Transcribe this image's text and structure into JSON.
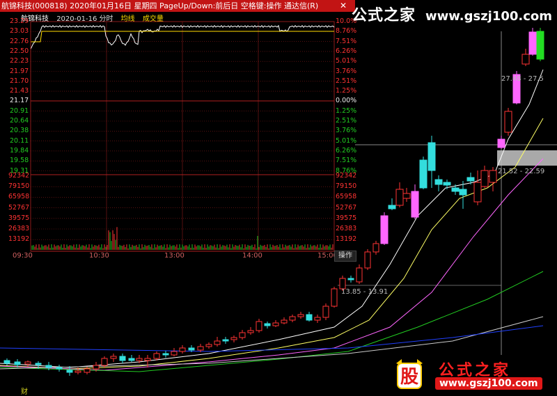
{
  "titlebar": {
    "text": "航锦科技(000818)  2020年01月16日  星期四  PageUp/Down:前后日  空格键:操作  通达信(R)",
    "close": "✕"
  },
  "subtitle": {
    "name": "航锦科技",
    "date": "2020-01-16 分时",
    "avg": "均线",
    "vol": "成交量"
  },
  "price_labels": [
    "23.29",
    "23.03",
    "22.76",
    "22.50",
    "22.23",
    "21.97",
    "21.70",
    "21.43",
    "21.17",
    "20.91",
    "20.64",
    "20.38",
    "20.11",
    "19.84",
    "19.58",
    "19.31"
  ],
  "pct_labels": [
    "10.0%",
    "8.76%",
    "7.51%",
    "6.26%",
    "5.01%",
    "3.76%",
    "2.51%",
    "1.25%",
    "0.00%",
    "1.25%",
    "2.51%",
    "3.76%",
    "5.01%",
    "6.26%",
    "7.51%",
    "8.76%"
  ],
  "volume_labels": [
    "92342",
    "79150",
    "65958",
    "52767",
    "39575",
    "26383",
    "13192"
  ],
  "time_labels": [
    "09:30",
    "10:30",
    "13:00",
    "14:00",
    "15:00"
  ],
  "operation_button": "操作",
  "range_labels": {
    "r1": "27.48 - 27.5",
    "r2": "21.52 - 22.59",
    "r3": "13.85 - 13.91"
  },
  "brand": {
    "top_cn": "公式之家",
    "top_url": "www.gszj100.com",
    "bottom_cn": "公式之家",
    "bottom_url": "www.gszj100.com",
    "logo_char": "股"
  },
  "bottom_marker": "财",
  "colors": {
    "up": "#ff3333",
    "down": "#22dddd",
    "magenta": "#ff66ff",
    "title_bg": "#c21414",
    "avg_line": "#ffde00"
  }
}
